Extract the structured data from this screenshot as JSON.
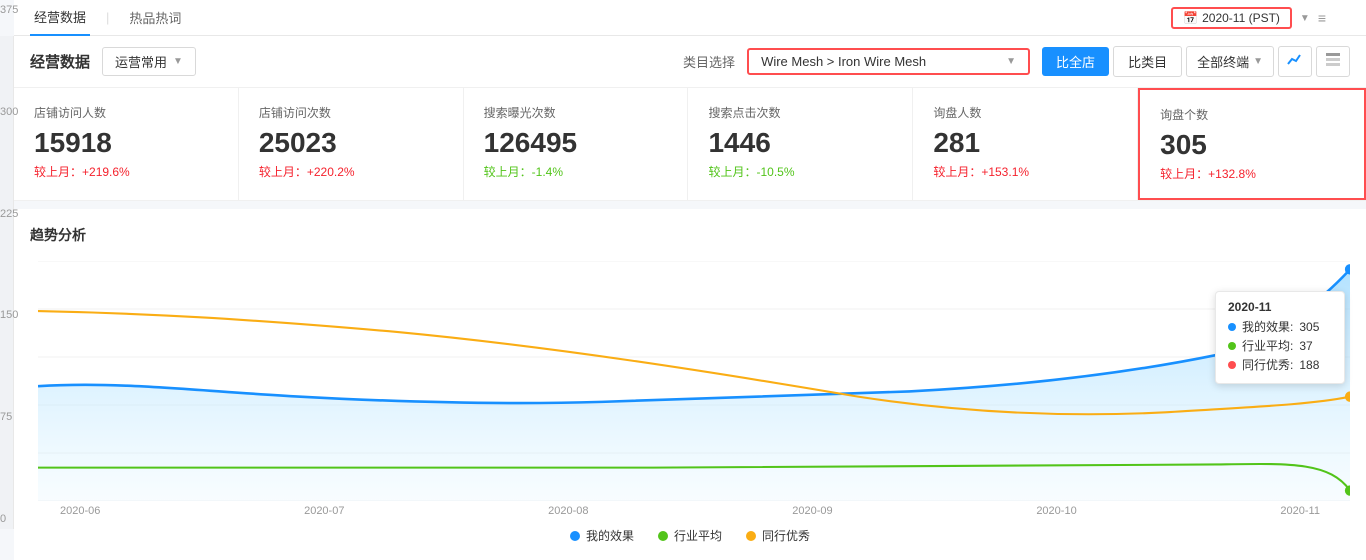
{
  "topNav": {
    "items": [
      {
        "label": "经营数据",
        "active": true
      },
      {
        "label": "热品热词",
        "active": false
      }
    ]
  },
  "dateSelector": {
    "icon": "📅",
    "label": "2020-11 (PST)"
  },
  "header": {
    "title": "经营数据",
    "dropdownLabel": "运营常用",
    "categoryLabel": "类目选择",
    "categoryValue": "Wire Mesh > Iron Wire Mesh",
    "btnCompareShop": "比全店",
    "btnCompareCategory": "比类目",
    "btnAllTerminals": "全部终端"
  },
  "metrics": [
    {
      "label": "店铺访问人数",
      "value": "15918",
      "changeLabel": "较上月：",
      "changeValue": "+219.6%",
      "positive": true
    },
    {
      "label": "店铺访问次数",
      "value": "25023",
      "changeLabel": "较上月：",
      "changeValue": "+220.2%",
      "positive": true
    },
    {
      "label": "搜索曝光次数",
      "value": "126495",
      "changeLabel": "较上月：",
      "changeValue": "-1.4%",
      "positive": false
    },
    {
      "label": "搜索点击次数",
      "value": "1446",
      "changeLabel": "较上月：",
      "changeValue": "-10.5%",
      "positive": false
    },
    {
      "label": "询盘人数",
      "value": "281",
      "changeLabel": "较上月：",
      "changeValue": "+153.1%",
      "positive": true
    },
    {
      "label": "询盘个数",
      "value": "305",
      "changeLabel": "较上月：",
      "changeValue": "+132.8%",
      "positive": true,
      "highlighted": true
    }
  ],
  "chart": {
    "title": "趋势分析",
    "yLabels": [
      "375",
      "300",
      "225",
      "150",
      "75",
      "0"
    ],
    "xLabels": [
      "2020-06",
      "2020-07",
      "2020-08",
      "2020-09",
      "2020-10",
      "2020-11"
    ],
    "tooltip": {
      "date": "2020-11",
      "rows": [
        {
          "color": "blue",
          "label": "我的效果:",
          "value": "305"
        },
        {
          "color": "green",
          "label": "行业平均:",
          "value": "37"
        },
        {
          "color": "red",
          "label": "同行优秀:",
          "value": "188"
        }
      ]
    },
    "legend": [
      {
        "color": "blue",
        "label": "我的效果"
      },
      {
        "color": "green-light",
        "label": "行业平均"
      },
      {
        "color": "yellow",
        "label": "同行优秀"
      }
    ]
  }
}
